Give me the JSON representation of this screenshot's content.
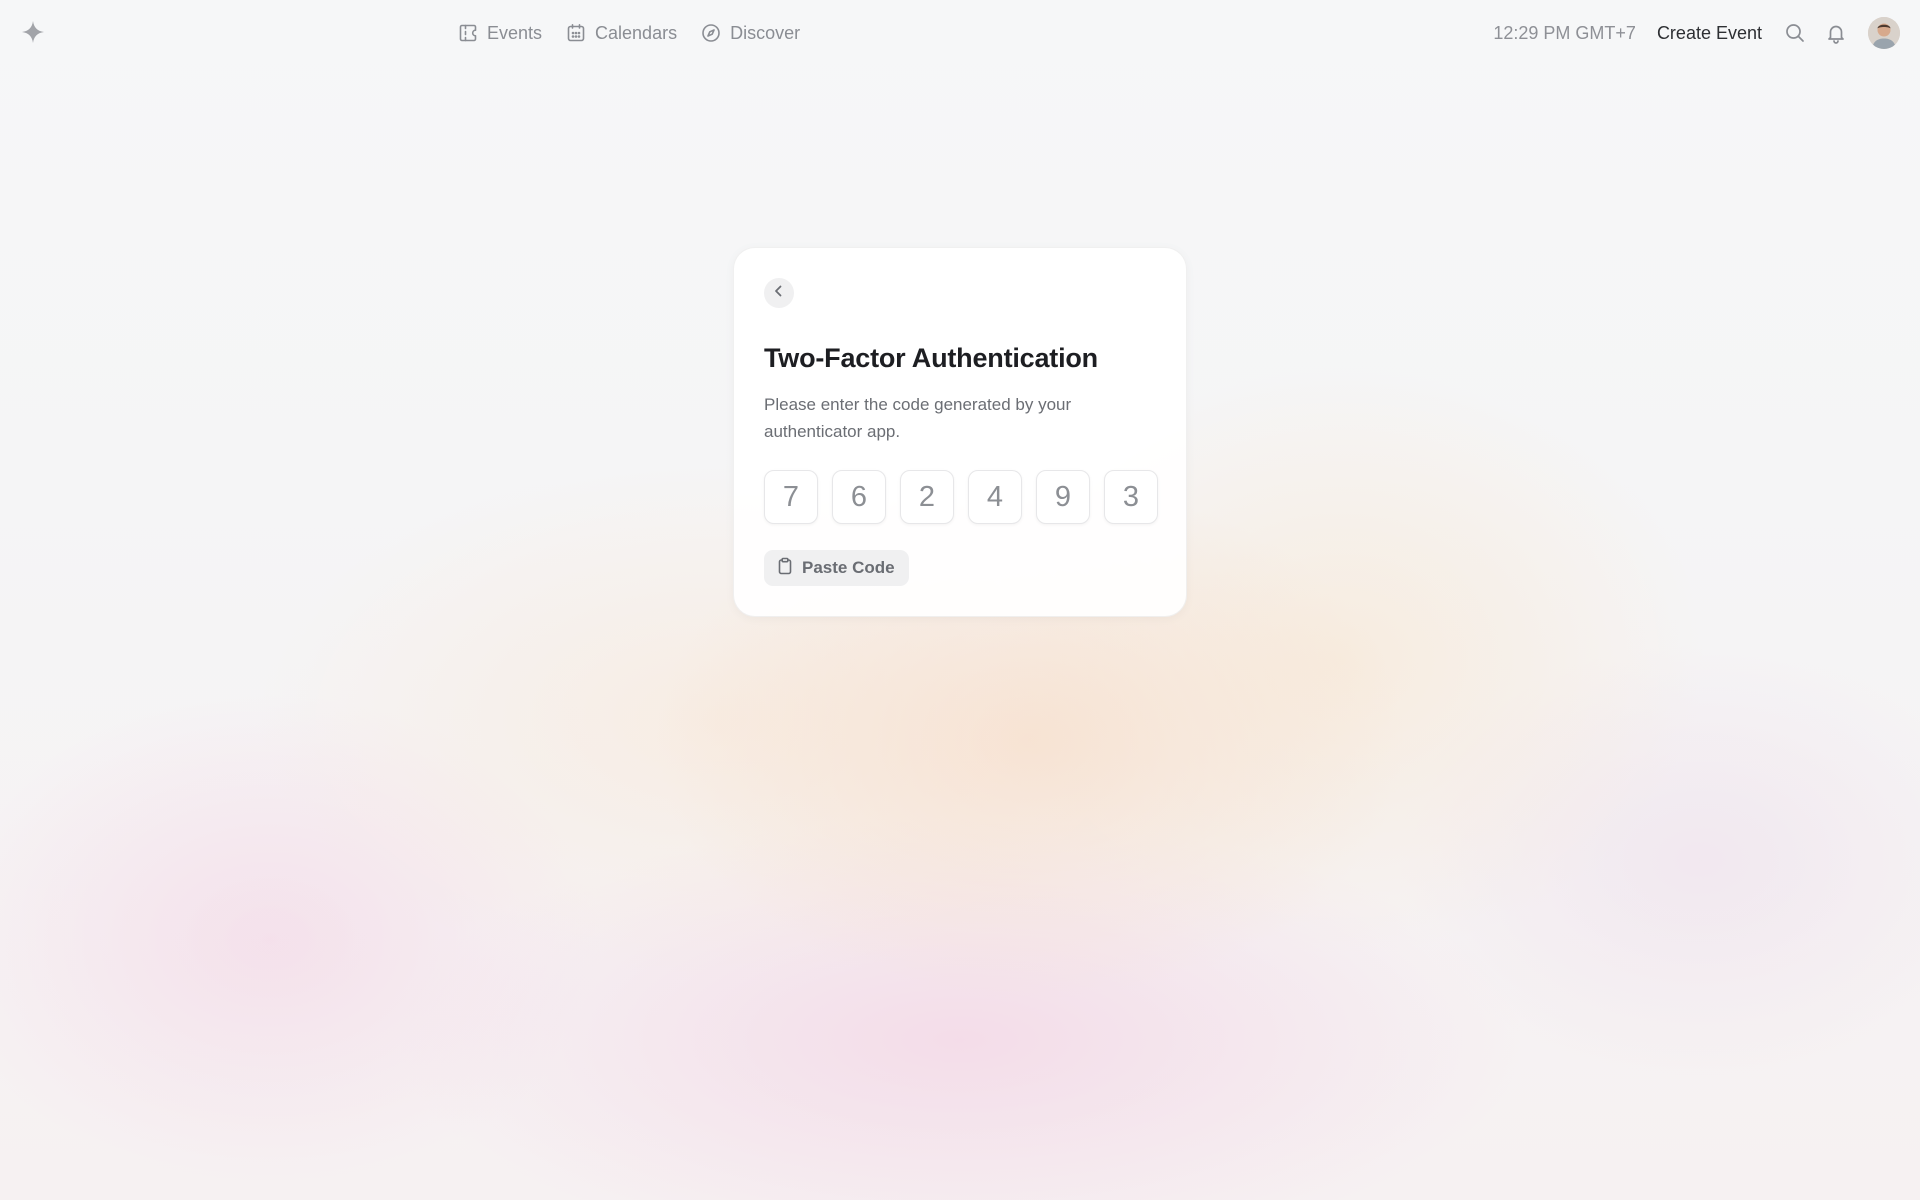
{
  "header": {
    "logo_icon": "sparkle-icon",
    "nav": [
      {
        "label": "Events",
        "icon": "ticket-icon"
      },
      {
        "label": "Calendars",
        "icon": "calendar-icon"
      },
      {
        "label": "Discover",
        "icon": "compass-icon"
      }
    ],
    "clock": "12:29 PM GMT+7",
    "create_event_label": "Create Event",
    "search_icon": "search-icon",
    "notifications_icon": "bell-icon",
    "avatar": "user-avatar"
  },
  "auth_card": {
    "back_icon": "chevron-left-icon",
    "title": "Two-Factor Authentication",
    "description": "Please enter the code generated by your authenticator app.",
    "code_digits": [
      "7",
      "6",
      "2",
      "4",
      "9",
      "3"
    ],
    "paste_label": "Paste Code",
    "paste_icon": "clipboard-icon"
  },
  "colors": {
    "nav_text": "#8a8d93",
    "title_text": "#1d1e22",
    "muted_text": "#6b6e74",
    "card_bg": "#ffffff"
  }
}
